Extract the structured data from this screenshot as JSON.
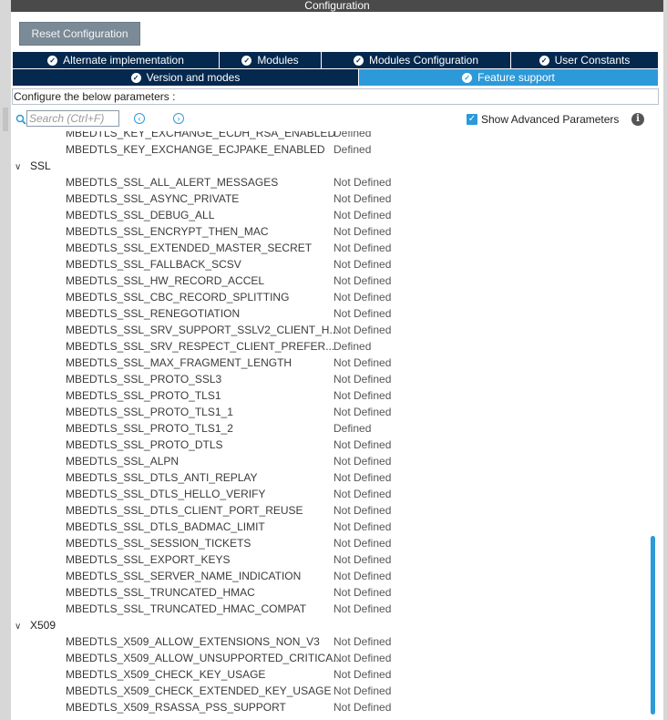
{
  "window": {
    "title": "Configuration"
  },
  "toolbar": {
    "reset_label": "Reset Configuration"
  },
  "tabs_row1": [
    {
      "label": "Alternate implementation",
      "active": false
    },
    {
      "label": "Modules",
      "active": false
    },
    {
      "label": "Modules Configuration",
      "active": false
    },
    {
      "label": "User Constants",
      "active": false
    }
  ],
  "tabs_row2": [
    {
      "label": "Version and modes",
      "active": false
    },
    {
      "label": "Feature support",
      "active": true
    }
  ],
  "config_label": "Configure the below parameters :",
  "search": {
    "placeholder": "Search (Ctrl+F)"
  },
  "advanced": {
    "label": "Show Advanced Parameters",
    "checked": true
  },
  "partial_row": {
    "name": "MBEDTLS_KEY_EXCHANGE_ECDH_RSA_ENABLED",
    "value": "Defined"
  },
  "tree": [
    {
      "type": "param",
      "name": "MBEDTLS_KEY_EXCHANGE_ECJPAKE_ENABLED",
      "value": "Defined"
    },
    {
      "type": "group",
      "name": "SSL"
    },
    {
      "type": "param",
      "name": "MBEDTLS_SSL_ALL_ALERT_MESSAGES",
      "value": "Not Defined"
    },
    {
      "type": "param",
      "name": "MBEDTLS_SSL_ASYNC_PRIVATE",
      "value": "Not Defined"
    },
    {
      "type": "param",
      "name": "MBEDTLS_SSL_DEBUG_ALL",
      "value": "Not Defined"
    },
    {
      "type": "param",
      "name": "MBEDTLS_SSL_ENCRYPT_THEN_MAC",
      "value": "Not Defined"
    },
    {
      "type": "param",
      "name": "MBEDTLS_SSL_EXTENDED_MASTER_SECRET",
      "value": "Not Defined"
    },
    {
      "type": "param",
      "name": "MBEDTLS_SSL_FALLBACK_SCSV",
      "value": "Not Defined"
    },
    {
      "type": "param",
      "name": "MBEDTLS_SSL_HW_RECORD_ACCEL",
      "value": "Not Defined"
    },
    {
      "type": "param",
      "name": "MBEDTLS_SSL_CBC_RECORD_SPLITTING",
      "value": "Not Defined"
    },
    {
      "type": "param",
      "name": "MBEDTLS_SSL_RENEGOTIATION",
      "value": "Not Defined"
    },
    {
      "type": "param",
      "name": "MBEDTLS_SSL_SRV_SUPPORT_SSLV2_CLIENT_H...",
      "value": "Not Defined"
    },
    {
      "type": "param",
      "name": "MBEDTLS_SSL_SRV_RESPECT_CLIENT_PREFER...",
      "value": "Defined"
    },
    {
      "type": "param",
      "name": "MBEDTLS_SSL_MAX_FRAGMENT_LENGTH",
      "value": "Not Defined"
    },
    {
      "type": "param",
      "name": "MBEDTLS_SSL_PROTO_SSL3",
      "value": "Not Defined"
    },
    {
      "type": "param",
      "name": "MBEDTLS_SSL_PROTO_TLS1",
      "value": "Not Defined"
    },
    {
      "type": "param",
      "name": "MBEDTLS_SSL_PROTO_TLS1_1",
      "value": "Not Defined"
    },
    {
      "type": "param",
      "name": "MBEDTLS_SSL_PROTO_TLS1_2",
      "value": "Defined"
    },
    {
      "type": "param",
      "name": "MBEDTLS_SSL_PROTO_DTLS",
      "value": "Not Defined"
    },
    {
      "type": "param",
      "name": "MBEDTLS_SSL_ALPN",
      "value": "Not Defined"
    },
    {
      "type": "param",
      "name": "MBEDTLS_SSL_DTLS_ANTI_REPLAY",
      "value": "Not Defined"
    },
    {
      "type": "param",
      "name": "MBEDTLS_SSL_DTLS_HELLO_VERIFY",
      "value": "Not Defined"
    },
    {
      "type": "param",
      "name": "MBEDTLS_SSL_DTLS_CLIENT_PORT_REUSE",
      "value": "Not Defined"
    },
    {
      "type": "param",
      "name": "MBEDTLS_SSL_DTLS_BADMAC_LIMIT",
      "value": "Not Defined"
    },
    {
      "type": "param",
      "name": "MBEDTLS_SSL_SESSION_TICKETS",
      "value": "Not Defined"
    },
    {
      "type": "param",
      "name": "MBEDTLS_SSL_EXPORT_KEYS",
      "value": "Not Defined"
    },
    {
      "type": "param",
      "name": "MBEDTLS_SSL_SERVER_NAME_INDICATION",
      "value": "Not Defined"
    },
    {
      "type": "param",
      "name": "MBEDTLS_SSL_TRUNCATED_HMAC",
      "value": "Not Defined"
    },
    {
      "type": "param",
      "name": "MBEDTLS_SSL_TRUNCATED_HMAC_COMPAT",
      "value": "Not Defined"
    },
    {
      "type": "group",
      "name": "X509"
    },
    {
      "type": "param",
      "name": "MBEDTLS_X509_ALLOW_EXTENSIONS_NON_V3",
      "value": "Not Defined"
    },
    {
      "type": "param",
      "name": "MBEDTLS_X509_ALLOW_UNSUPPORTED_CRITICA...",
      "value": "Not Defined"
    },
    {
      "type": "param",
      "name": "MBEDTLS_X509_CHECK_KEY_USAGE",
      "value": "Not Defined"
    },
    {
      "type": "param",
      "name": "MBEDTLS_X509_CHECK_EXTENDED_KEY_USAGE",
      "value": "Not Defined"
    },
    {
      "type": "param",
      "name": "MBEDTLS_X509_RSASSA_PSS_SUPPORT",
      "value": "Not Defined"
    }
  ]
}
